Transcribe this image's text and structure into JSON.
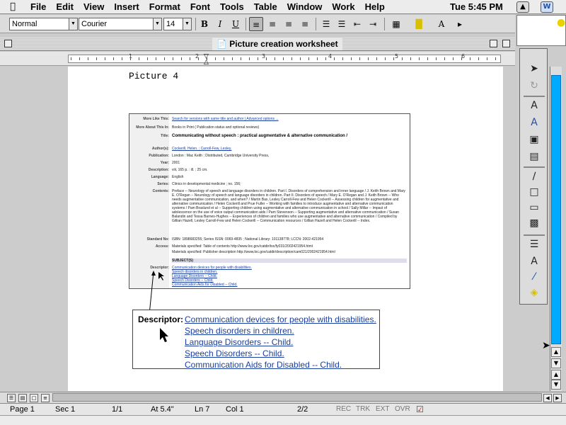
{
  "menubar": {
    "menus": [
      "File",
      "Edit",
      "View",
      "Insert",
      "Format",
      "Font",
      "Tools",
      "Table",
      "Window",
      "Work",
      "Help"
    ],
    "clock": "Tue 5:45 PM"
  },
  "toolbar": {
    "style": "Normal",
    "font": "Courier",
    "size": "14",
    "bold": "B",
    "italic": "I",
    "underline": "U"
  },
  "window": {
    "title": "Picture creation worksheet"
  },
  "ruler": {
    "numbers": [
      "1",
      "2",
      "3",
      "4",
      "5",
      "6"
    ]
  },
  "document": {
    "heading": "Picture 4",
    "record": {
      "rows": [
        {
          "label": "More Like This:",
          "value": "Search for versions with same title and author | Advanced options ...",
          "link": true
        },
        {
          "label": "More About This In:",
          "value": "Books in Print ( Publication status and optional reviews)",
          "link": false
        },
        {
          "label": "Title:",
          "value": "Communicating without speech : practical augmentative & alternative communication /",
          "link": false,
          "title": true
        },
        {
          "label": "Author(s):",
          "value": "Cockerill, Helen. ; Carroll-Few, Lesley.",
          "link": true
        },
        {
          "label": "Publication:",
          "value": "London : Mac Keith ; Distributed, Cambridge University Press,",
          "link": false
        },
        {
          "label": "Year:",
          "value": "2001",
          "link": false
        },
        {
          "label": "Description:",
          "value": "viii, 165 p. : ill. ; 25 cm.",
          "link": false
        },
        {
          "label": "Language:",
          "value": "English",
          "link": false
        },
        {
          "label": "Series:",
          "value": "Clinics in developmental medicine ; no. 156;",
          "link": false
        },
        {
          "label": "Contents:",
          "value": "Preface -- Neurology of speech and language disorders in children. Part I. Disorders of comprehension and inner language / J. Keith Brown and Mary E. O'Regan -- Neurology of speech and language disorders in children. Part II. Disorders of speech / Mary E. O'Regan and J. Keith Brown -- Who needs augmentative communication, and when? / Martin Bax, Lesley Carroll-Few and Helen Cockerill -- Assessing children for augmentative and alternative communication / Helen Cockerill and Prue Fuller -- Working with families to introduce augmentative and alternative communication systems / Pam Braslund et al -- Supporting children using augmentative and alternative communication in school / Sally Millar -- Impact of adolescence on the use of voice output communication aids / Pam Stevenson -- Supporting augmentative and alternative communication / Susan Balandin and Tessa Barnes-Hughes -- Experiences of children and families who use augmentative and alternative communication / Compiled by Gillian Hazell, Lesley Carroll-Few and Helen Cockerill -- Communication resources / Gillian Hazell and Helen Cockerill -- Index.",
          "link": false
        },
        {
          "label": "Standard No:",
          "value": "ISBN: 1898683255; Series ISSN: 0069-4835 ; National Library: 101138778; LCCN: 2002-421954",
          "link": false
        },
        {
          "label": "Access:",
          "value": "Materials specified: Table of contents http://www.loc.gov/catdir/toc/fy031/2002421954.html",
          "link": false
        },
        {
          "label": "",
          "value": "Materials specified: Publisher description http://www.loc.gov/catdir/description/cam021/2002421954.html",
          "link": false
        }
      ],
      "subjects_header": "SUBJECT(S)",
      "descriptor_label": "Descriptor:",
      "descriptors": [
        "Communication devices for people with disabilities.",
        "Speech disorders in children.",
        "Language Disorders -- Child.",
        "Speech Disorders -- Child.",
        "Communication Aids for Disabled -- Child."
      ]
    },
    "zoom": {
      "label": "Descriptor:",
      "links": [
        "Communication devices for people with disabilities.",
        "Speech disorders in children.",
        "Language Disorders -- Child.",
        "Speech Disorders -- Child.",
        "Communication Aids for Disabled -- Child."
      ]
    }
  },
  "statusbar": {
    "page": "Page 1",
    "sec": "Sec 1",
    "pages": "1/1",
    "at": "At 5.4\"",
    "ln": "Ln 7",
    "col": "Col 1",
    "count": "2/2",
    "rec": "REC",
    "trk": "TRK",
    "ext": "EXT",
    "ovr": "OVR"
  },
  "colors": {
    "scroll_thumb": "#00aaff",
    "link": "#1a3fa0"
  }
}
